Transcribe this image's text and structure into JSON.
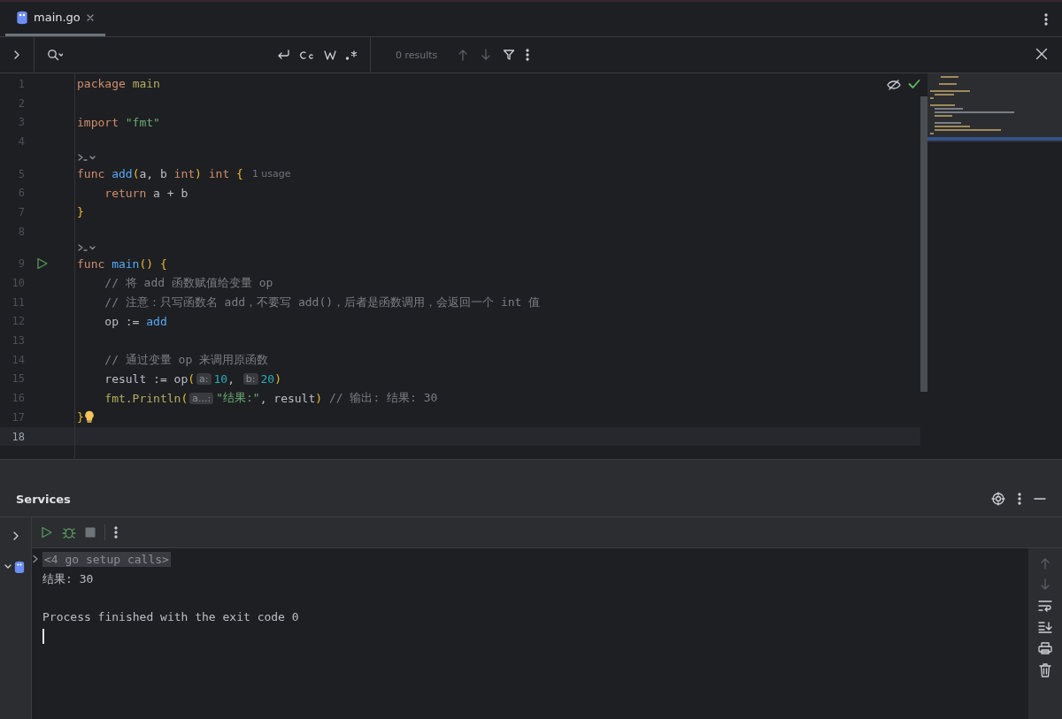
{
  "tabs": [
    {
      "label": "main.go",
      "selected": true
    }
  ],
  "search": {
    "results": "0 results"
  },
  "editor": {
    "lines": [
      {
        "number": "1",
        "tokens": [
          {
            "kind": "keyword",
            "text": "package "
          },
          {
            "kind": "package",
            "text": "main"
          }
        ]
      },
      {
        "number": "2"
      },
      {
        "number": "3",
        "tokens": [
          {
            "kind": "keyword",
            "text": "import "
          },
          {
            "kind": "string",
            "text": "\"fmt\""
          }
        ]
      },
      {
        "number": "4"
      },
      {
        "number": "5",
        "code_vision": true,
        "tokens": [
          {
            "kind": "keyword",
            "text": "func "
          },
          {
            "kind": "function",
            "text": "add"
          },
          {
            "kind": "brace",
            "text": "("
          },
          {
            "kind": "plain",
            "text": "a, b "
          },
          {
            "kind": "keyword",
            "text": "int"
          },
          {
            "kind": "brace",
            "text": ")"
          },
          {
            "kind": "keyword",
            "text": " int "
          },
          {
            "kind": "brace",
            "text": "{"
          },
          {
            "kind": "usage",
            "text": "1 usage"
          }
        ]
      },
      {
        "number": "6",
        "tokens": [
          {
            "kind": "keyword",
            "text": "    return"
          },
          {
            "kind": "plain",
            "text": " a + b"
          }
        ]
      },
      {
        "number": "7",
        "tokens": [
          {
            "kind": "brace",
            "text": "}"
          }
        ]
      },
      {
        "number": "8"
      },
      {
        "number": "9",
        "code_vision": true,
        "run": true,
        "tokens": [
          {
            "kind": "keyword",
            "text": "func "
          },
          {
            "kind": "function",
            "text": "main"
          },
          {
            "kind": "brace",
            "text": "()"
          },
          {
            "kind": "brace",
            "text": " {"
          }
        ]
      },
      {
        "number": "10",
        "tokens": [
          {
            "kind": "comment",
            "text": "    // 将 add 函数赋值给变量 op"
          }
        ]
      },
      {
        "number": "11",
        "tokens": [
          {
            "kind": "comment",
            "text": "    // 注意：只写函数名 add，不要写 add()，后者是函数调用，会返回一个 int 值"
          }
        ]
      },
      {
        "number": "12",
        "tokens": [
          {
            "kind": "plain",
            "text": "    op := "
          },
          {
            "kind": "function",
            "text": "add"
          }
        ]
      },
      {
        "number": "13"
      },
      {
        "number": "14",
        "tokens": [
          {
            "kind": "comment",
            "text": "    // 通过变量 op 来调用原函数"
          }
        ]
      },
      {
        "number": "15",
        "tokens": [
          {
            "kind": "plain",
            "text": "    result := op"
          },
          {
            "kind": "brace",
            "text": "("
          },
          {
            "kind": "hint",
            "text": "a:"
          },
          {
            "kind": "number",
            "text": "10"
          },
          {
            "kind": "plain",
            "text": ", "
          },
          {
            "kind": "hint",
            "text": "b:"
          },
          {
            "kind": "number",
            "text": "20"
          },
          {
            "kind": "brace",
            "text": ")"
          }
        ]
      },
      {
        "number": "16",
        "tokens": [
          {
            "kind": "call",
            "text": "    fmt.Println"
          },
          {
            "kind": "brace",
            "text": "("
          },
          {
            "kind": "hint",
            "text": "a...:"
          },
          {
            "kind": "string",
            "text": "\"结果:\""
          },
          {
            "kind": "plain",
            "text": ", result"
          },
          {
            "kind": "brace",
            "text": ")"
          },
          {
            "kind": "comment",
            "text": " // 输出: 结果: 30"
          }
        ]
      },
      {
        "number": "17",
        "bulb": true,
        "tokens": [
          {
            "kind": "brace",
            "text": "}"
          }
        ]
      },
      {
        "number": "18",
        "current": true
      }
    ]
  },
  "services": {
    "title": "Services",
    "console": [
      {
        "kind": "fold",
        "text": "<4 go setup calls>"
      },
      {
        "kind": "output",
        "text": "结果: 30"
      },
      {
        "kind": "blank"
      },
      {
        "kind": "output",
        "text": "Process finished with the exit code 0"
      },
      {
        "kind": "caret"
      }
    ]
  }
}
